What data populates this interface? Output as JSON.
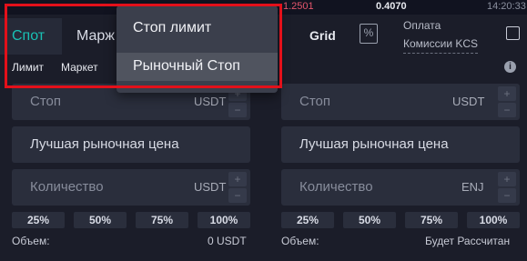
{
  "ticker": {
    "price_red": "1.2501",
    "price_white": "0.4070",
    "time": "14:20:33"
  },
  "tabs": {
    "spot": "Спот",
    "margin": "Марж"
  },
  "header": {
    "grid": "Grid",
    "percent_icon": "%",
    "fee_line1": "Оплата",
    "fee_line2": "Комиссии KCS"
  },
  "subtabs": {
    "limit": "Лимит",
    "market": "Маркет"
  },
  "dropdown": {
    "items": [
      "Стоп лимит",
      "Рыночный Стоп"
    ],
    "selected_index": 1
  },
  "buy": {
    "stop_label": "Стоп",
    "stop_unit": "USDT",
    "best_price": "Лучшая рыночная цена",
    "qty_label": "Количество",
    "qty_unit": "USDT",
    "percents": [
      "25%",
      "50%",
      "75%",
      "100%"
    ],
    "volume_label": "Объем:",
    "volume_value": "0 USDT"
  },
  "sell": {
    "stop_label": "Стоп",
    "stop_unit": "USDT",
    "best_price": "Лучшая рыночная цена",
    "qty_label": "Количество",
    "qty_unit": "ENJ",
    "percents": [
      "25%",
      "50%",
      "75%",
      "100%"
    ],
    "volume_label": "Объем:",
    "volume_value": "Будет Рассчитан"
  },
  "stepper": {
    "plus": "+",
    "minus": "−"
  },
  "colors": {
    "accent": "#19c1b5",
    "background": "#1b1d29",
    "field": "#2a2e3c",
    "dropdown": "#3b3f4c",
    "highlight": "#e3101a",
    "ticker_red": "#e4566c"
  }
}
